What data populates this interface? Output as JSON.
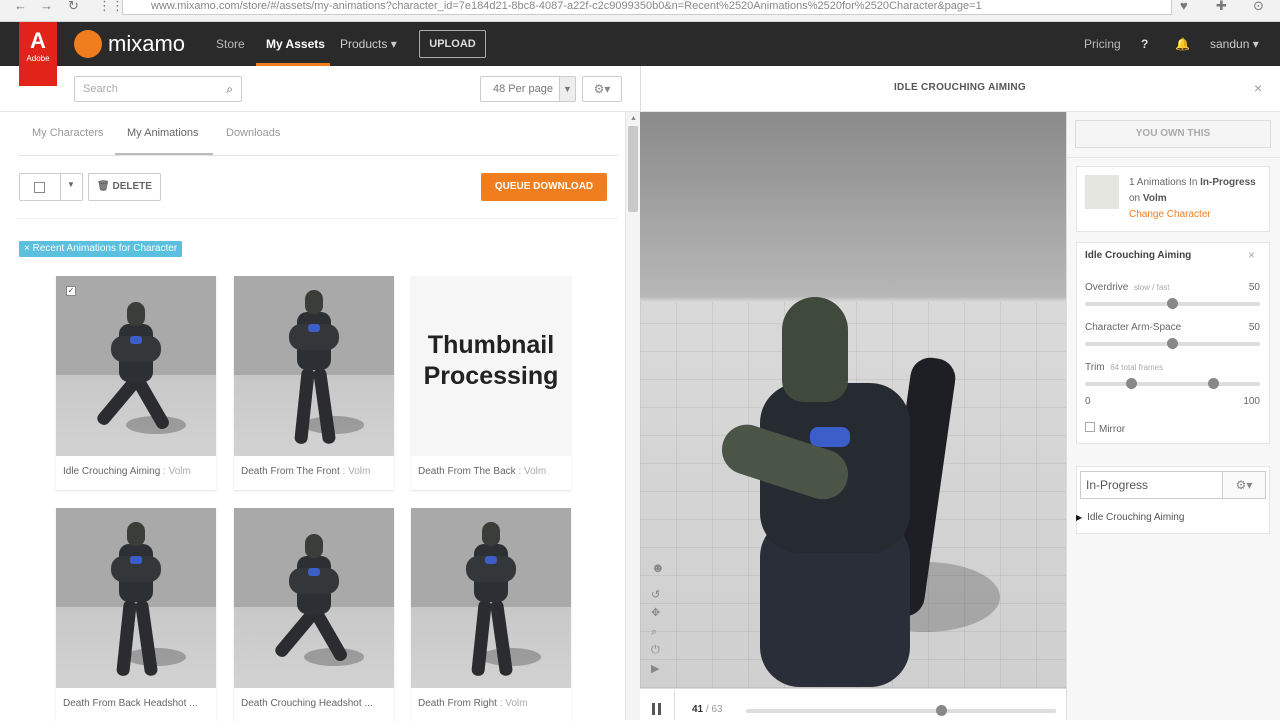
{
  "browser": {
    "url": "www.mixamo.com/store/#/assets/my-animations?character_id=7e184d21-8bc8-4087-a22f-c2c9099350b0&n=Recent%2520Animations%2520for%2520Character&page=1"
  },
  "brand": {
    "adobe_letter": "A",
    "adobe_text": "Adobe",
    "logo_text": "mixamo",
    "accent": "#f07d1e",
    "adobe_red": "#e2231a"
  },
  "nav": {
    "store": "Store",
    "my_assets": "My Assets",
    "products": "Products ▾",
    "upload": "UPLOAD",
    "pricing": "Pricing",
    "help_icon": "?",
    "bell_icon": "🔔",
    "user": "sandun ▾"
  },
  "toolbar": {
    "search_placeholder": "Search",
    "per_page": "48 Per page",
    "gear": "⚙▾"
  },
  "tabs": [
    "My Characters",
    "My Animations",
    "Downloads"
  ],
  "actions": {
    "delete": "🗑 DELETE",
    "queue_download": "QUEUE DOWNLOAD"
  },
  "filter_tag": "× Recent Animations for Character",
  "cards": [
    {
      "title": "Idle Crouching Aiming",
      "char": " : Volm"
    },
    {
      "title": "Death From The Front",
      "char": " : Volm"
    },
    {
      "title": "Death From The Back",
      "char": " : Volm",
      "processing_text": "Thumbnail Processing"
    },
    {
      "title": "Death From Back Headshot ...",
      "char": ""
    },
    {
      "title": "Death Crouching Headshot ...",
      "char": ""
    },
    {
      "title": "Death From Right",
      "char": " : Volm"
    }
  ],
  "viewer": {
    "title": "IDLE CROUCHING AIMING",
    "close": "×",
    "frame_current": "41",
    "frame_total": " / 63",
    "progress_fraction": 0.63
  },
  "sidebar": {
    "own": "YOU OWN THIS",
    "char_count_pre": "1 Animations In ",
    "char_status": "In-Progress",
    "char_on": " on ",
    "char_name": "Volm",
    "change_character": "Change Character",
    "anim_name": "Idle Crouching Aiming",
    "anim_close": "×",
    "overdrive_label": "Overdrive",
    "overdrive_hint": "slow / fast",
    "overdrive_value": "50",
    "armspace_label": "Character Arm-Space",
    "armspace_value": "50",
    "trim_label": "Trim",
    "trim_hint": "64 total frames",
    "trim_min": "0",
    "trim_max": "100",
    "mirror": "Mirror",
    "queue_select": "In-Progress",
    "queue_gear": "⚙▾",
    "queue_item": "Idle Crouching Aiming"
  }
}
